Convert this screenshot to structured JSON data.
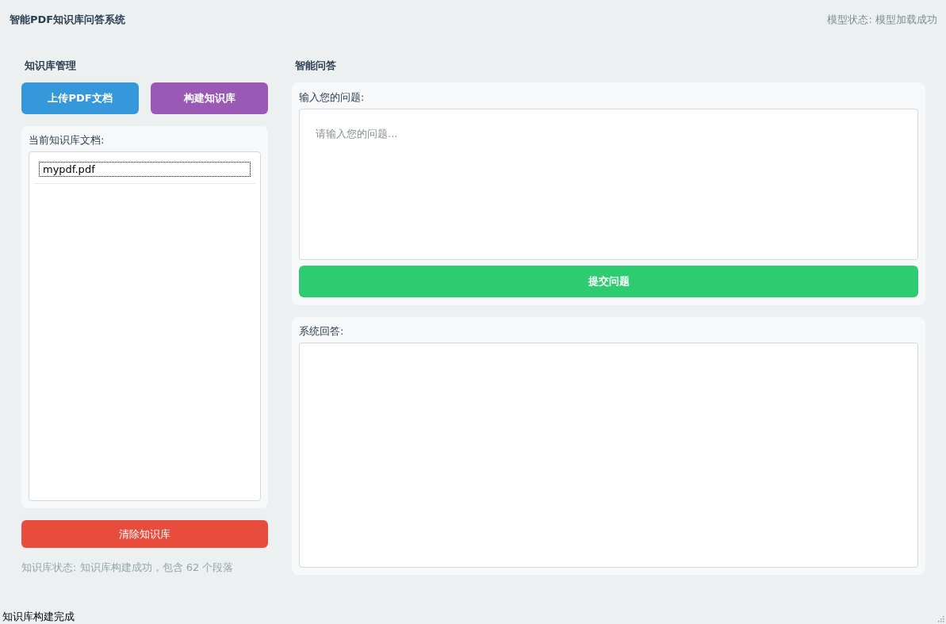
{
  "header": {
    "title": "智能PDF知识库问答系统",
    "model_status": "模型状态: 模型加载成功"
  },
  "knowledge_base": {
    "title": "知识库管理",
    "buttons": [
      {
        "label": "上传PDF文档",
        "kind": "upload"
      },
      {
        "label": "构建知识库",
        "kind": "build"
      }
    ],
    "documents_label": "当前知识库文档:",
    "documents": [
      {
        "name": "mypdf.pdf",
        "selected": true
      }
    ],
    "clear_button": "清除知识库",
    "status": "知识库状态: 知识库构建成功，包含 62 个段落"
  },
  "qa": {
    "title": "智能问答",
    "question_label": "输入您的问题:",
    "question_placeholder": "请输入您的问题...",
    "submit_button": "提交问题",
    "answer_label": "系统回答:"
  },
  "status_bar": "知识库构建完成"
}
